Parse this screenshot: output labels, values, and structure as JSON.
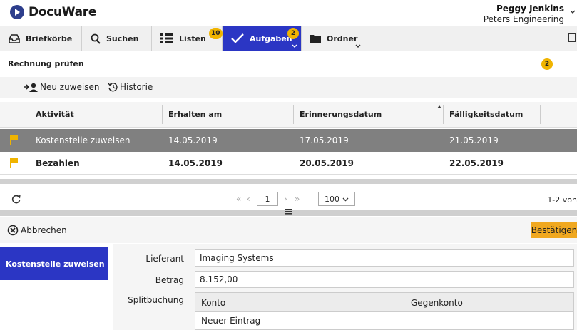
{
  "header": {
    "brand": "DocuWare",
    "user_name": "Peggy Jenkins",
    "user_company": "Peters Engineering",
    "user_menu_icon": "chevron-down-icon"
  },
  "nav": {
    "items": [
      {
        "label": "Briefkörbe",
        "icon": "tray-icon",
        "badge": "",
        "active": false
      },
      {
        "label": "Suchen",
        "icon": "search-icon",
        "badge": "",
        "active": false
      },
      {
        "label": "Listen",
        "icon": "list-icon",
        "badge": "10",
        "active": false
      },
      {
        "label": "Aufgaben",
        "icon": "check-icon",
        "badge": "2",
        "active": true
      },
      {
        "label": "Ordner",
        "icon": "folder-icon",
        "badge": "",
        "active": false
      }
    ],
    "accent": "#2b36c4",
    "badge_color": "#f0b400"
  },
  "task": {
    "title": "Rechnung prüfen",
    "badge": "2"
  },
  "toolbar": {
    "reassign_label": "Neu zuweisen",
    "history_label": "Historie"
  },
  "table": {
    "columns": [
      "Aktivität",
      "Erhalten am",
      "Erinnerungsdatum",
      "Fälligkeitsdatum"
    ],
    "rows": [
      {
        "activity": "Kostenstelle zuweisen",
        "received": "14.05.2019",
        "reminder": "17.05.2019",
        "due": "21.05.2019",
        "selected": true
      },
      {
        "activity": "Bezahlen",
        "received": "14.05.2019",
        "reminder": "20.05.2019",
        "due": "22.05.2019",
        "selected": false
      }
    ]
  },
  "pager": {
    "first": "«",
    "prev": "‹",
    "page": "1",
    "next": "›",
    "last": "»",
    "page_size": "100",
    "count": "1-2 von"
  },
  "form": {
    "cancel_label": "Abbrechen",
    "confirm_label": "Bestätigen",
    "step_label": "Kostenstelle zuweisen",
    "fields": {
      "supplier_label": "Lieferant",
      "supplier_value": "Imaging Systems",
      "amount_label": "Betrag",
      "amount_value": "8.152,00",
      "split_label": "Splitbuchung"
    },
    "grid": {
      "col_account": "Konto",
      "col_contra": "Gegenkonto",
      "new_entry": "Neuer Eintrag"
    }
  }
}
